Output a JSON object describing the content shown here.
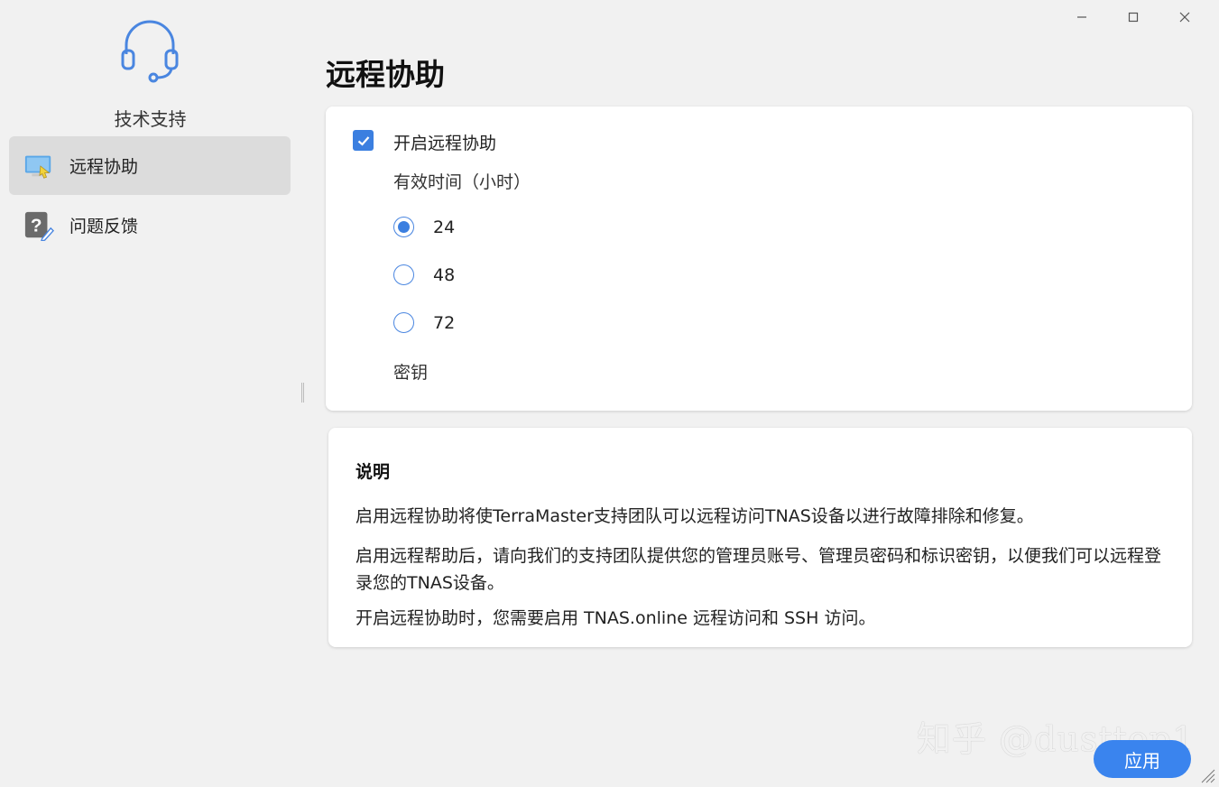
{
  "window": {
    "controls": [
      "minimize",
      "maximize",
      "close"
    ]
  },
  "sidebar": {
    "app_title": "技术支持",
    "items": [
      {
        "label": "远程协助",
        "icon": "monitor-icon",
        "active": true
      },
      {
        "label": "问题反馈",
        "icon": "help-icon",
        "active": false
      }
    ]
  },
  "main": {
    "title": "远程协助",
    "settings": {
      "enable_label": "开启远程协助",
      "enabled": true,
      "duration_label": "有效时间（小时）",
      "durations": [
        "24",
        "48",
        "72"
      ],
      "selected_duration": "24",
      "key_label": "密钥"
    },
    "info": {
      "title": "说明",
      "paragraphs": [
        "启用远程协助将使TerraMaster支持团队可以远程访问TNAS设备以进行故障排除和修复。",
        "启用远程帮助后，请向我们的支持团队提供您的管理员账号、管理员密码和标识密钥，以便我们可以远程登录您的TNAS设备。",
        "开启远程协助时，您需要启用 TNAS.online 远程访问和 SSH 访问。"
      ]
    },
    "apply_label": "应用"
  },
  "watermark": "知乎 @dusttop1",
  "colors": {
    "accent": "#3b7fe0",
    "sidebar_active": "#dcdcdc",
    "background": "#f1f1f1"
  }
}
